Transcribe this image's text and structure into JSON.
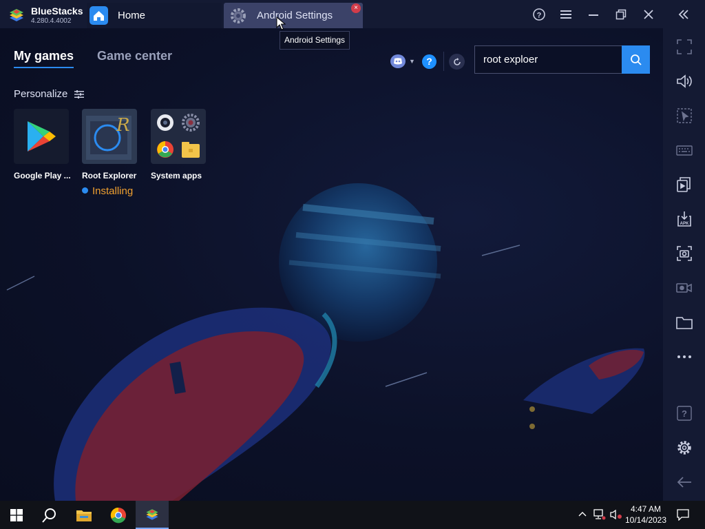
{
  "app": {
    "name": "BlueStacks",
    "version": "4.280.4.4002"
  },
  "tabs": [
    {
      "label": "Home",
      "icon": "home-icon"
    },
    {
      "label": "Android Settings",
      "icon": "gear-icon"
    }
  ],
  "tooltip": "Android Settings",
  "nav": {
    "my_games": "My games",
    "game_center": "Game center"
  },
  "search": {
    "value": "root exploer",
    "icon": "search-icon"
  },
  "personalize": "Personalize",
  "apps": [
    {
      "name": "Google Play ...",
      "icon": "google-play-icon"
    },
    {
      "name": "Root Explorer",
      "icon": "root-explorer-icon",
      "status": "Installing"
    },
    {
      "name": "System apps",
      "icon": "system-apps-folder-icon"
    }
  ],
  "help_badge": "?",
  "sidebar_icons": [
    "fullscreen-icon",
    "volume-icon",
    "cursor-lock-icon",
    "keyboard-icon",
    "multi-instance-icon",
    "install-apk-icon",
    "screenshot-icon",
    "record-icon",
    "folder-icon",
    "more-icon",
    "help-icon",
    "settings-icon",
    "back-icon"
  ],
  "taskbar": {
    "time": "4:47 AM",
    "date": "10/14/2023"
  },
  "colors": {
    "accent": "#2b8bf0",
    "installing": "#f0a030",
    "titlebar": "#141a33",
    "background": "#0b0f22"
  }
}
